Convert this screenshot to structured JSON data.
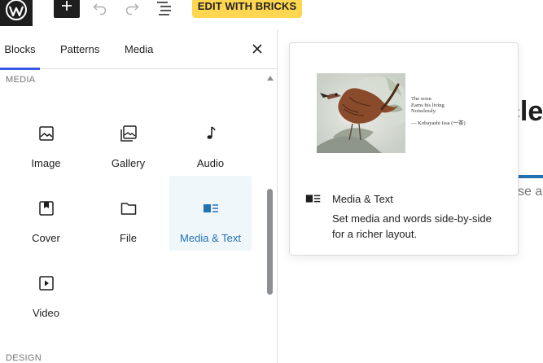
{
  "toolbar": {
    "bricks_label": "EDIT WITH BRICKS"
  },
  "inserter": {
    "tabs": [
      {
        "label": "Blocks"
      },
      {
        "label": "Patterns"
      },
      {
        "label": "Media"
      }
    ],
    "categories": {
      "media": "MEDIA",
      "design": "DESIGN"
    },
    "blocks": [
      {
        "label": "Image",
        "icon": "image-icon"
      },
      {
        "label": "Gallery",
        "icon": "gallery-icon"
      },
      {
        "label": "Audio",
        "icon": "audio-icon"
      },
      {
        "label": "Cover",
        "icon": "cover-icon"
      },
      {
        "label": "File",
        "icon": "file-icon"
      },
      {
        "label": "Media & Text",
        "icon": "media-text-icon"
      },
      {
        "label": "Video",
        "icon": "video-icon"
      }
    ]
  },
  "preview": {
    "title": "Media & Text",
    "description": "Set media and words side-by-side for a richer layout.",
    "poem_lines": [
      "The wren",
      "Earns his living",
      "Noiselessly."
    ],
    "poem_attribution": "— Kobayashi Issa (一茶)"
  },
  "canvas": {
    "title_fragment": "cle",
    "text_fragment": "se a"
  },
  "colors": {
    "accent": "#3858e9",
    "bricks": "#ffd64f",
    "hover_text": "#2271b1",
    "hover_bg": "#f0f7fb"
  }
}
